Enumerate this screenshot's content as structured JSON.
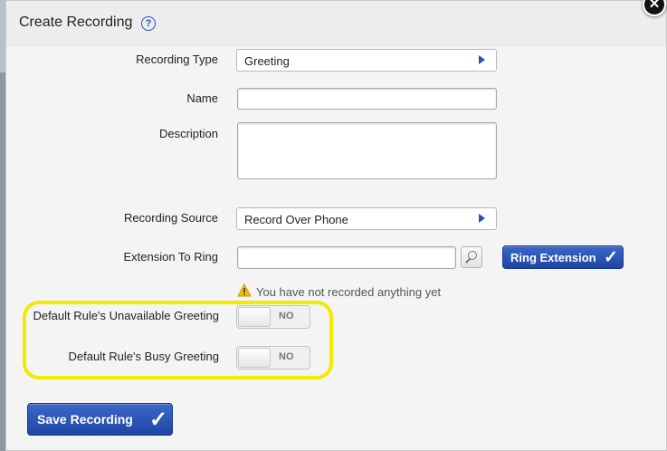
{
  "dialog": {
    "title": "Create Recording",
    "help_glyph": "?",
    "close_glyph": "✕"
  },
  "form": {
    "recording_type": {
      "label": "Recording Type",
      "value": "Greeting"
    },
    "name": {
      "label": "Name",
      "value": ""
    },
    "description": {
      "label": "Description",
      "value": ""
    },
    "recording_source": {
      "label": "Recording Source",
      "value": "Record Over Phone"
    },
    "extension_to_ring": {
      "label": "Extension To Ring",
      "value": ""
    },
    "ring_extension_button": "Ring Extension",
    "warning": {
      "icon_glyph": "⚠",
      "text": "You have not recorded anything yet"
    },
    "unavailable_greeting": {
      "label": "Default Rule's Unavailable Greeting",
      "state": "NO"
    },
    "busy_greeting": {
      "label": "Default Rule's Busy Greeting",
      "state": "NO"
    }
  },
  "footer": {
    "save_button": "Save Recording"
  },
  "check_glyph": "✓",
  "colors": {
    "accent": "#2a4fb5",
    "highlight": "#f2ea00",
    "warning": "#f2c200"
  }
}
